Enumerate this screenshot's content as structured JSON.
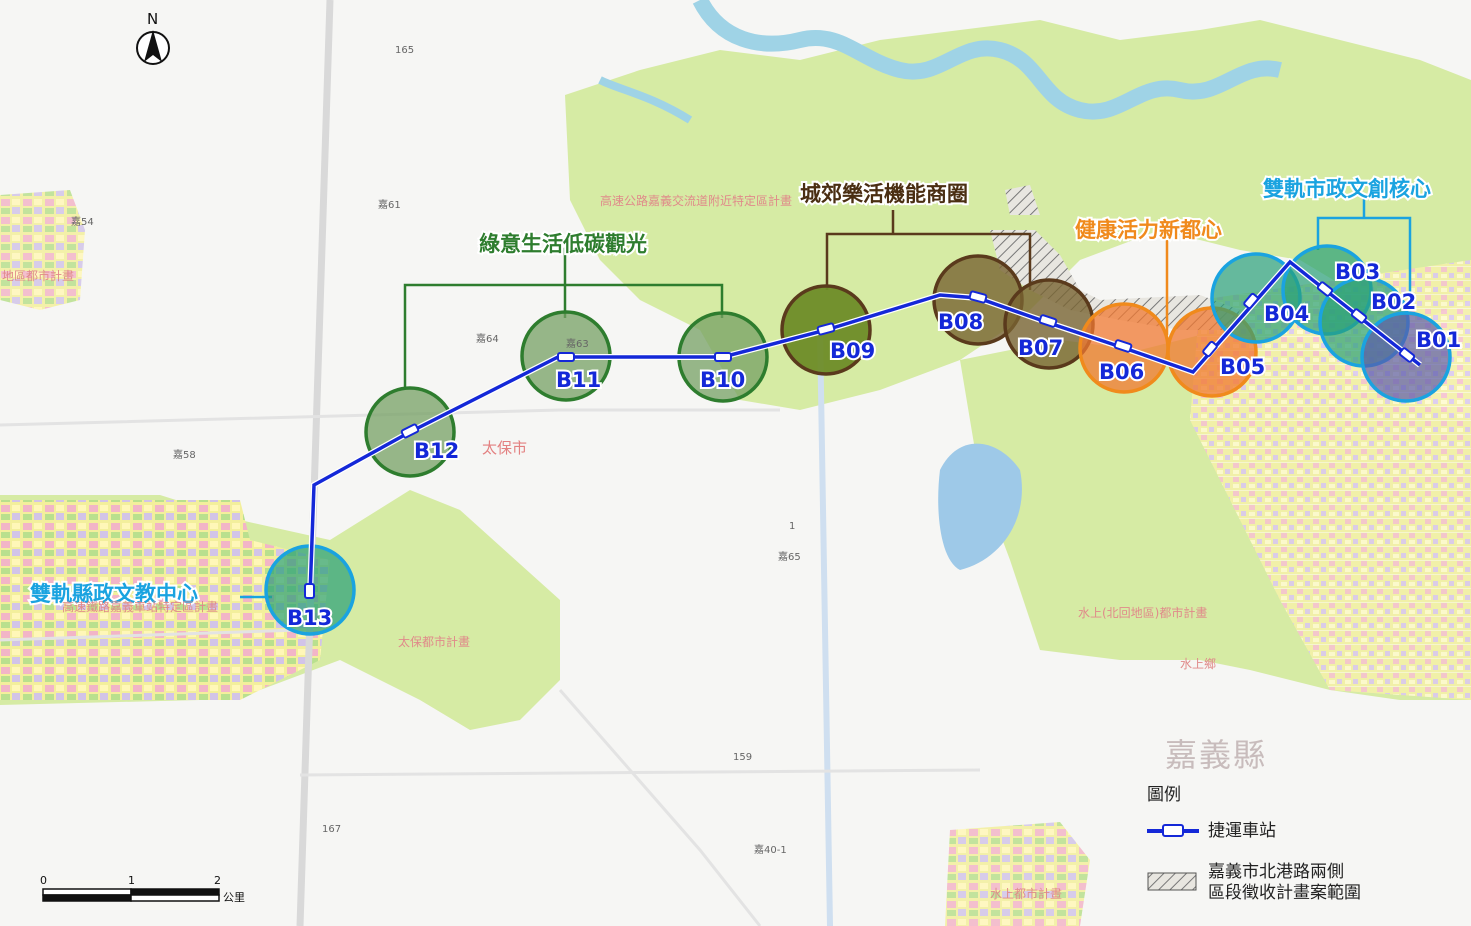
{
  "north_arrow": {
    "label": "N",
    "icon": "north-arrow-icon"
  },
  "zones": [
    {
      "id": "green",
      "label": "綠意生活低碳觀光",
      "color": "#2e7d2e"
    },
    {
      "id": "brown",
      "label": "城郊樂活機能商圈",
      "color": "#5a3a1c"
    },
    {
      "id": "orange",
      "label": "健康活力新都心",
      "color": "#f08a1c"
    },
    {
      "id": "cyan-east",
      "label": "雙軌市政文創核心",
      "color": "#1aa3e0"
    },
    {
      "id": "cyan-west",
      "label": "雙軌縣政文教中心",
      "color": "#1aa3e0"
    }
  ],
  "stations": [
    "B01",
    "B02",
    "B03",
    "B04",
    "B05",
    "B06",
    "B07",
    "B08",
    "B09",
    "B10",
    "B11",
    "B12",
    "B13"
  ],
  "place_names": {
    "taibao_city": "太保市",
    "chiayi_county": "嘉義縣",
    "taibao_plan": "太保都市計畫",
    "shuishang_north_plan": "水上(北回地區)都市計畫",
    "shuishang_plan": "水上都市計畫",
    "shuishang_township": "水上鄉",
    "highway_plan": "高速公路嘉義交流道附近特定區計畫",
    "hsr_plan": "高速鐵路嘉義車站特定區計畫",
    "west_plan": "地區都市計畫"
  },
  "roads": {
    "r1": "1",
    "r165": "165",
    "r167": "167",
    "r159": "159",
    "r40_1": "嘉40-1",
    "r63": "嘉63",
    "r64": "嘉64",
    "r65": "嘉65",
    "r58": "嘉58",
    "r61": "嘉61",
    "r54": "嘉54"
  },
  "legend": {
    "title": "圖例",
    "items": [
      {
        "label": "捷運車站",
        "icon": "mrt-station-line-icon"
      },
      {
        "label": "嘉義市北港路兩側\n區段徵收計畫案範圍",
        "icon": "hatched-area-icon"
      }
    ]
  },
  "scale_bar": {
    "ticks": [
      "0",
      "1",
      "2"
    ],
    "unit": "公里"
  }
}
